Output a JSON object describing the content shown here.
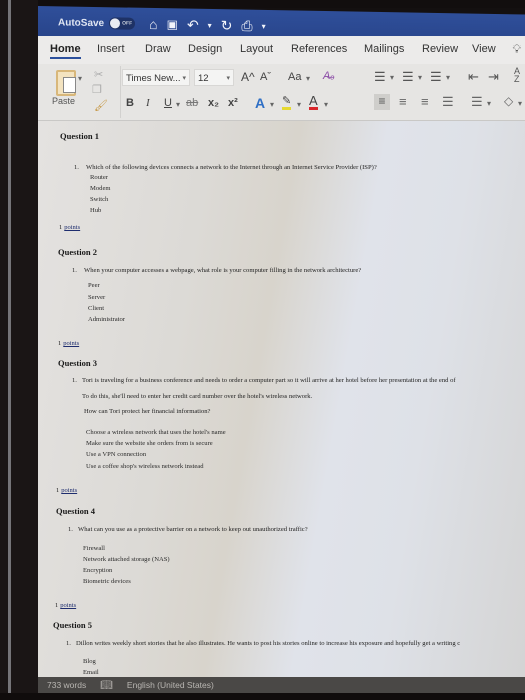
{
  "titlebar": {
    "autosave_label": "AutoSave",
    "autosave_state": "OFF",
    "quick_access": [
      {
        "icon": "home-icon",
        "glyph": "⌂"
      },
      {
        "icon": "save-icon",
        "glyph": "🖫"
      },
      {
        "icon": "undo-icon",
        "glyph": "↶"
      },
      {
        "icon": "undo-dropdown-icon",
        "glyph": "⌄"
      },
      {
        "icon": "redo-icon",
        "glyph": "↻"
      },
      {
        "icon": "print-icon",
        "glyph": "⎙"
      },
      {
        "icon": "customize-toolbar-icon",
        "glyph": "▾"
      }
    ]
  },
  "ribbon_tabs": {
    "home": "Home",
    "insert": "Insert",
    "draw": "Draw",
    "design": "Design",
    "layout": "Layout",
    "references": "References",
    "mailings": "Mailings",
    "review": "Review",
    "view": "View"
  },
  "ribbon": {
    "paste_label": "Paste",
    "font_name": "Times New...",
    "font_size": "12",
    "grow_font": "A^",
    "shrink_font": "Aˇ",
    "change_case": "Aa",
    "bold": "B",
    "italic": "I",
    "underline": "U",
    "strikethrough": "ab",
    "subscript": "x₂",
    "superscript": "x²",
    "text_effects": "A",
    "highlight": "✎",
    "font_color": "A",
    "font_color_hex": "#d9262b",
    "highlight_hex": "#e6d930"
  },
  "document": {
    "questions": [
      {
        "title": "Question 1",
        "number": "1.",
        "text": "Which of the following devices connects a network to the Internet through an Internet Service Provider (ISP)?",
        "options": [
          "Router",
          "Modem",
          "Switch",
          "Hub"
        ],
        "points_value": "1",
        "points_label": "points"
      },
      {
        "title": "Question 2",
        "number": "1.",
        "text": "When your computer accesses a webpage, what role is your computer filling in the network architecture?",
        "options": [
          "Peer",
          "Server",
          "Client",
          "Administrator"
        ],
        "points_value": "1",
        "points_label": "points"
      },
      {
        "title": "Question 3",
        "number": "1.",
        "text": "Tori is traveling for a business conference and needs to order a computer part so it will arrive at her hotel before her presentation at the end of",
        "text2": "To do this, she'll need to enter her credit card number over the hotel's wireless network.",
        "text3": "How can Tori protect her financial information?",
        "options": [
          "Choose a wireless network that uses the hotel's name",
          "Make sure the website she orders from is secure",
          "Use a VPN connection",
          "Use a coffee shop's wireless network instead"
        ],
        "points_value": "1",
        "points_label": "points"
      },
      {
        "title": "Question 4",
        "number": "1.",
        "text": "What can you use as a protective barrier on a network to keep out unauthorized traffic?",
        "options": [
          "Firewall",
          "Network attached storage (NAS)",
          "Encryption",
          "Biometric devices"
        ],
        "points_value": "1",
        "points_label": "points"
      },
      {
        "title": "Question 5",
        "number": "1.",
        "text": "Dillon writes weekly short stories that he also illustrates. He wants to post his stories online to increase his exposure and hopefully get a writing c",
        "options": [
          "Blog",
          "Email"
        ]
      }
    ]
  },
  "statusbar": {
    "word_count": "733 words",
    "language": "English (United States)"
  }
}
